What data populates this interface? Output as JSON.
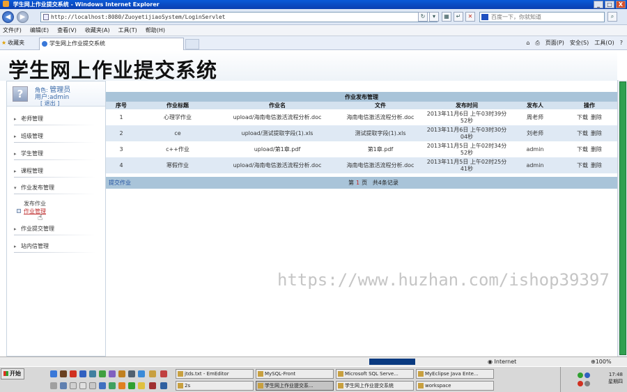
{
  "window": {
    "title": "学生网上作业提交系统 - Windows Internet Explorer",
    "minimize": "_",
    "maximize": "□",
    "close": "X"
  },
  "browser": {
    "back": "◀",
    "forward": "▶",
    "url": "http://localhost:8080/ZuoyetijiaoSystem/LoginServlet",
    "search_placeholder": "百度一下，你就知道",
    "menu": [
      "文件(F)",
      "编辑(E)",
      "查看(V)",
      "收藏夹(A)",
      "工具(T)",
      "帮助(H)"
    ],
    "favorites_label": "收藏夹",
    "tab_title": "学生网上作业提交系统",
    "commands": [
      "页面(P)",
      "安全(S)",
      "工具(O)"
    ]
  },
  "page": {
    "system_title": "学生网上作业提交系统",
    "user": {
      "role_label": "角色:",
      "role": "管理员",
      "user_label": "用户:",
      "username": "admin",
      "logout": "[ 退出 ]"
    },
    "menu": [
      {
        "label": "老师管理"
      },
      {
        "label": "班级管理"
      },
      {
        "label": "学生管理"
      },
      {
        "label": "课程管理"
      },
      {
        "label": "作业发布管理"
      },
      {
        "label": "作业提交管理"
      },
      {
        "label": "站内信管理"
      }
    ],
    "submenu": [
      {
        "label": "发布作业"
      },
      {
        "label": "作业管理"
      }
    ],
    "table": {
      "title": "作业发布管理",
      "headers": [
        "序号",
        "作业标题",
        "作业名",
        "文件",
        "发布时间",
        "发布人",
        "操作"
      ],
      "rows": [
        {
          "no": "1",
          "title": "心理学作业",
          "name": "upload/海南电信激活流程分析.doc",
          "file": "海南电信激活流程分析.doc",
          "time": "2013年11月6日 上午03时39分52秒",
          "publisher": "周老师"
        },
        {
          "no": "2",
          "title": "ce",
          "name": "upload/测试提取字段(1).xls",
          "file": "测试提取字段(1).xls",
          "time": "2013年11月6日 上午03时30分04秒",
          "publisher": "刘老师"
        },
        {
          "no": "3",
          "title": "c++作业",
          "name": "upload/第1章.pdf",
          "file": "第1章.pdf",
          "time": "2013年11月5日 上午02时34分52秒",
          "publisher": "admin"
        },
        {
          "no": "4",
          "title": "寒假作业",
          "name": "upload/海南电信激活流程分析.doc",
          "file": "海南电信激活流程分析.doc",
          "time": "2013年11月5日 上午02时25分41秒",
          "publisher": "admin"
        }
      ],
      "download": "下载",
      "delete": "删除",
      "submit_link": "提交作业",
      "pager": {
        "prefix": "第",
        "current": "1",
        "suffix": "页",
        "total": "共4条记录"
      }
    },
    "watermark": "https://www.huzhan.com/ishop39397"
  },
  "statusbar": {
    "zone": "Internet",
    "zoom": "100%"
  },
  "taskbar": {
    "start": "开始",
    "tasks": [
      "jtds.txt - EmEditor",
      "MySQL-Front",
      "Microsoft SQL Serve...",
      "MyEclipse Java Ente...",
      "2s",
      "学生网上作业提交系...",
      "学生网上作业提交系统",
      "workspace"
    ],
    "time": "17:48",
    "day": "星期四"
  }
}
